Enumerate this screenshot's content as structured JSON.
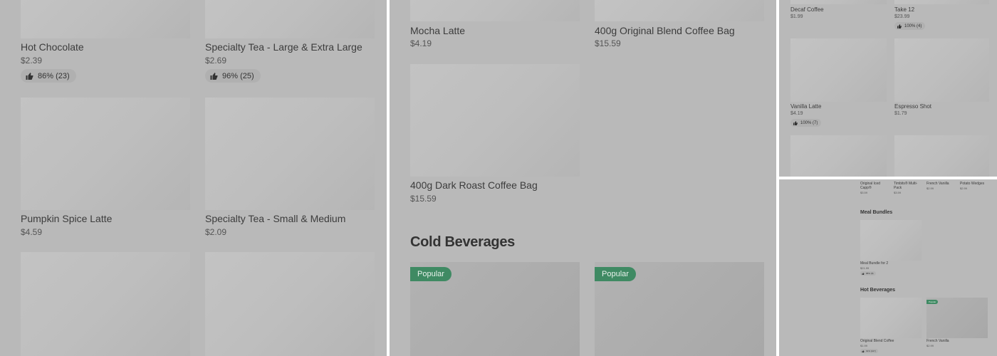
{
  "panel_a": {
    "items": [
      {
        "name": "Hot Chocolate",
        "price": "$2.39",
        "rating": "86% (23)"
      },
      {
        "name": "Specialty Tea - Large & Extra Large",
        "price": "$2.69",
        "rating": "96% (25)"
      },
      {
        "name": "Pumpkin Spice Latte",
        "price": "$4.59"
      },
      {
        "name": "Specialty Tea - Small & Medium",
        "price": "$2.09"
      }
    ]
  },
  "panel_b": {
    "items": [
      {
        "name": "Mocha Latte",
        "price": "$4.19"
      },
      {
        "name": "400g Original Blend Coffee Bag",
        "price": "$15.59"
      },
      {
        "name": "400g Dark Roast Coffee Bag",
        "price": "$15.59"
      }
    ],
    "section_heading": "Cold Beverages",
    "badges": [
      "Popular",
      "Popular"
    ]
  },
  "panel_c": {
    "items": [
      {
        "name": "Decaf Coffee",
        "price": "$1.99"
      },
      {
        "name": "Take 12",
        "price": "$23.99",
        "rating": "100% (4)"
      },
      {
        "name": "Vanilla Latte",
        "price": "$4.19",
        "rating": "100% (7)"
      },
      {
        "name": "Espresso Shot",
        "price": "$1.79"
      }
    ]
  },
  "panel_d": {
    "top_items": [
      {
        "name": "Original Iced Capp®",
        "price": "$3.59"
      },
      {
        "name": "Timbits® Multi-Pack",
        "price": "$3.59"
      },
      {
        "name": "French Vanilla",
        "price": "$2.99"
      },
      {
        "name": "Potato Wedges",
        "price": "$2.99"
      }
    ],
    "meal_bundles": {
      "heading": "Meal Bundles",
      "item": {
        "name": "Meal Bundle for 2",
        "price": "$21.99",
        "rating": "88% (8)"
      }
    },
    "hot_beverages": {
      "heading": "Hot Beverages",
      "badge": "Popular",
      "items": [
        {
          "name": "Original Blend Coffee",
          "price": "$1.99",
          "rating": "91% (107)"
        },
        {
          "name": "French Vanilla",
          "price": "$2.99"
        }
      ]
    }
  },
  "icon_names": [
    "thumbs-up-icon"
  ]
}
